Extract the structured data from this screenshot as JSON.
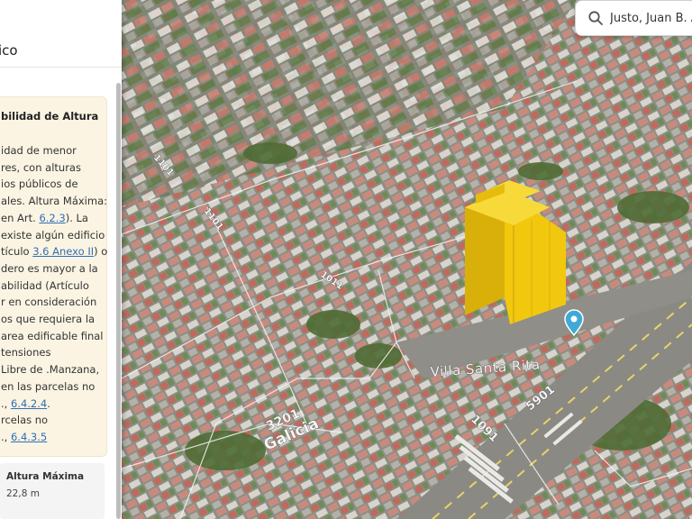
{
  "panel": {
    "title": "ico",
    "info": {
      "heading": "bilidad de Altura",
      "lines": [
        {
          "parts": [
            {
              "text": "idad de menor"
            }
          ]
        },
        {
          "parts": [
            {
              "text": "res, con alturas"
            }
          ]
        },
        {
          "parts": [
            {
              "text": "ios públicos de"
            }
          ]
        },
        {
          "parts": [
            {
              "text": "ales. Altura Máxima:"
            }
          ]
        },
        {
          "parts": [
            {
              "text": " en Art. "
            },
            {
              "text": "6.2.3",
              "link": true
            },
            {
              "text": "). La"
            }
          ]
        },
        {
          "parts": [
            {
              "text": "existe algún edificio"
            }
          ]
        },
        {
          "parts": [
            {
              "text": "tículo "
            },
            {
              "text": "3.6 Anexo II",
              "link": true
            },
            {
              "text": ") o"
            }
          ]
        },
        {
          "parts": [
            {
              "text": "dero es mayor a la"
            }
          ]
        },
        {
          "parts": [
            {
              "text": "abilidad (Artículo"
            }
          ]
        },
        {
          "parts": [
            {
              "text": "r en consideración"
            }
          ]
        },
        {
          "parts": [
            {
              "text": "os que requiera la"
            }
          ]
        },
        {
          "parts": [
            {
              "text": "area edificable final"
            }
          ]
        },
        {
          "parts": [
            {
              "text": "tensiones"
            }
          ]
        },
        {
          "parts": [
            {
              "text": "Libre de .Manzana,"
            }
          ]
        },
        {
          "parts": [
            {
              "text": "en las parcelas no"
            }
          ]
        },
        {
          "parts": [
            {
              "text": "., "
            },
            {
              "text": "6.4.2.4",
              "link": true
            },
            {
              "text": "."
            }
          ]
        },
        {
          "parts": [
            {
              "text": "rcelas no"
            }
          ]
        },
        {
          "parts": [
            {
              "text": "., "
            },
            {
              "text": "6.4.3.5",
              "link": true
            }
          ]
        }
      ]
    },
    "metric": {
      "label": "Altura Máxima",
      "value": "22,8 m"
    }
  },
  "search": {
    "value": "Justo, Juan B. Av"
  },
  "map": {
    "place_label": "Villa Santa Rita",
    "street_labels": [
      {
        "text": "3201",
        "name": "street-number-3201"
      },
      {
        "text": "Galicia",
        "name": "street-name-galicia"
      },
      {
        "text": "1091",
        "name": "street-number-1091"
      },
      {
        "text": "5901",
        "name": "street-number-5901"
      },
      {
        "text": "1101",
        "name": "street-number-1101"
      },
      {
        "text": "1011",
        "name": "street-number-1011"
      },
      {
        "text": "1101",
        "name": "street-number-1101-b"
      }
    ],
    "colors": {
      "building": "#f2c80f",
      "marker": "#3fa9d8"
    }
  }
}
